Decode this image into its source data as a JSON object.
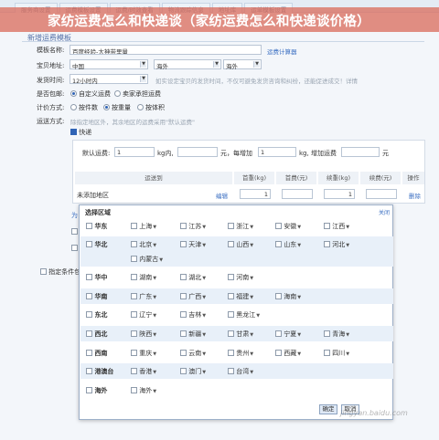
{
  "tabs": [
    "服务商设置",
    "运费模板设置",
    "运费/时效查看",
    "物流跟踪信息",
    "地址库",
    "运单模板设置"
  ],
  "banner_title": "家纺运费怎么和快递谈（家纺运费怎么和快递谈价格）",
  "section_title": "新增运费模板",
  "form": {
    "name_label": "模板名称:",
    "name_value": "百度经验-大神带里量",
    "calc_link": "运费计算器",
    "address_label": "宝贝地址:",
    "country": "中国",
    "province": "海外",
    "city": "海外",
    "ship_time_label": "发货时间:",
    "ship_time": "12小时内",
    "ship_time_hint": "如实设定宝贝的发货时间，不仅可避免发货咨询和纠纷，还能促进成交！详情",
    "free_ship_label": "是否包邮:",
    "free_ship_options": [
      "自定义运费",
      "卖家承担运费"
    ],
    "pricing_label": "计价方式:",
    "pricing_options": [
      "按件数",
      "按重量",
      "按体积"
    ],
    "method_label": "运送方式:",
    "method_hint": "除指定地区外，其余地区的运费采用\"默认运费\"",
    "express_label": "快递"
  },
  "panel": {
    "default_prefix": "默认运费:",
    "default_first": "1",
    "unit1": "kg内,",
    "default_price": "",
    "unit2": "元，每增加",
    "default_add": "1",
    "unit3": "kg, 增加运费",
    "default_add_price": "",
    "unit4": "元",
    "headers": [
      "运送到",
      "首重(kg)",
      "首费(元)",
      "续重(kg)",
      "续费(元)",
      "操作"
    ],
    "row": {
      "dest": "未添加地区",
      "edit": "编辑",
      "first_kg": "1",
      "first_fee": "",
      "add_kg": "1",
      "add_fee": "",
      "del": "删除"
    }
  },
  "bg_partial": {
    "left_label": "为",
    "bottom_label": "指定条件包"
  },
  "dialog": {
    "title": "选择区域",
    "close": "关闭",
    "ok": "确定",
    "cancel": "取消",
    "regions": [
      {
        "name": "华东",
        "provinces": [
          "上海",
          "江苏",
          "浙江",
          "安徽",
          "江西"
        ]
      },
      {
        "name": "华北",
        "provinces": [
          "北京",
          "天津",
          "山西",
          "山东",
          "河北",
          "内蒙古"
        ]
      },
      {
        "name": "华中",
        "provinces": [
          "湖南",
          "湖北",
          "河南"
        ]
      },
      {
        "name": "华南",
        "provinces": [
          "广东",
          "广西",
          "福建",
          "海南"
        ]
      },
      {
        "name": "东北",
        "provinces": [
          "辽宁",
          "吉林",
          "黑龙江"
        ]
      },
      {
        "name": "西北",
        "provinces": [
          "陕西",
          "新疆",
          "甘肃",
          "宁夏",
          "青海"
        ]
      },
      {
        "name": "西南",
        "provinces": [
          "重庆",
          "云南",
          "贵州",
          "西藏",
          "四川"
        ]
      },
      {
        "name": "港澳台",
        "provinces": [
          "香港",
          "澳门",
          "台湾"
        ]
      },
      {
        "name": "海外",
        "provinces": [
          "海外"
        ]
      }
    ]
  },
  "watermark": "jingyan.baidu.com",
  "colors": {
    "banner": "#da7060",
    "accent": "#2f63b5",
    "link": "#3b6fc2"
  }
}
